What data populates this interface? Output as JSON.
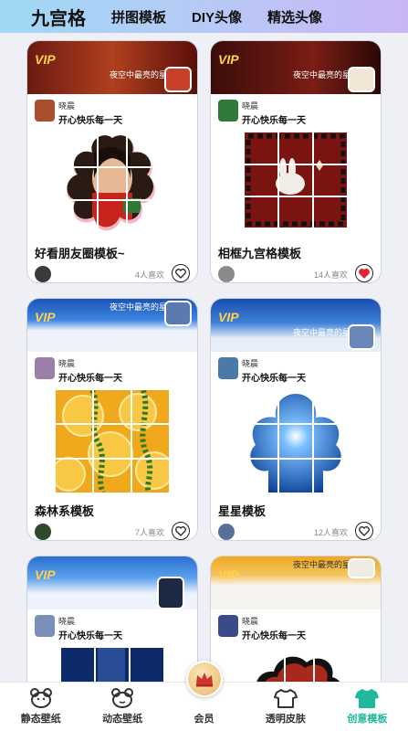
{
  "top_tabs": [
    {
      "label": "九宫格",
      "active": true
    },
    {
      "label": "拼图模板",
      "active": false
    },
    {
      "label": "DIY头像",
      "active": false
    },
    {
      "label": "精选头像",
      "active": false
    }
  ],
  "card_common": {
    "vip_text": "VIP",
    "slogan": "夜空中最亮的星",
    "user_name": "晓晨",
    "user_motto": "开心快乐每一天"
  },
  "cards": [
    {
      "title": "好看朋友圈模板~",
      "likes": "4人喜欢",
      "liked": false
    },
    {
      "title": "相框九宫格模板",
      "likes": "14人喜欢",
      "liked": true
    },
    {
      "title": "森林系模板",
      "likes": "7人喜欢",
      "liked": false
    },
    {
      "title": "星星模板",
      "likes": "12人喜欢",
      "liked": false
    },
    {
      "title": "",
      "likes": "",
      "liked": false
    },
    {
      "title": "",
      "likes": "",
      "liked": false
    }
  ],
  "bottom_nav": [
    {
      "label": "静态壁纸",
      "icon": "bear-icon",
      "active": false
    },
    {
      "label": "动态壁纸",
      "icon": "bear-outline-icon",
      "active": false
    },
    {
      "label": "会员",
      "icon": "crown-icon",
      "active": false
    },
    {
      "label": "透明皮肤",
      "icon": "tshirt-icon",
      "active": false
    },
    {
      "label": "创意模板",
      "icon": "tshirt-filled-icon",
      "active": true
    }
  ],
  "colors": {
    "accent": "#1fb89a",
    "liked_heart": "#e0253a",
    "vip_gold": "#ffd24a"
  }
}
